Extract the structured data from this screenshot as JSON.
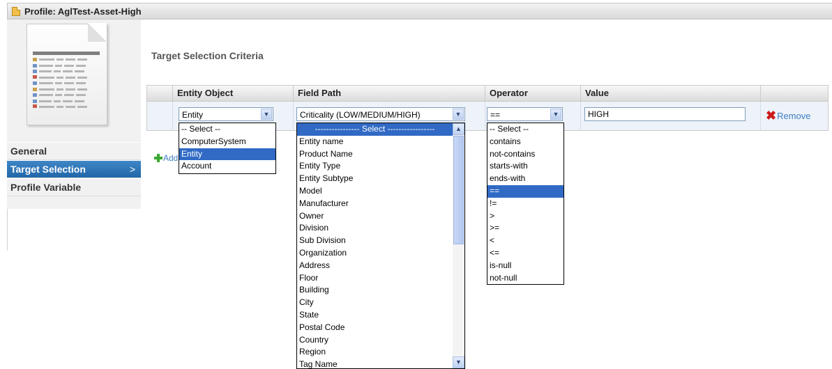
{
  "window": {
    "title": "Profile: AglTest-Asset-High"
  },
  "nav": {
    "items": [
      {
        "label": "General",
        "active": false
      },
      {
        "label": "Target Selection",
        "active": true,
        "chevron": ">"
      },
      {
        "label": "Profile Variable",
        "active": false
      }
    ]
  },
  "section": {
    "heading": "Target Selection Criteria"
  },
  "grid": {
    "columns": [
      "Entity Object",
      "Field Path",
      "Operator",
      "Value"
    ],
    "row": {
      "entity_object": "Entity",
      "field_path": "Criticality (LOW/MEDIUM/HIGH)",
      "operator": "==",
      "value": "HIGH",
      "remove_label": "Remove"
    }
  },
  "add_link": "Add",
  "dropdowns": {
    "entity_object": {
      "options": [
        "-- Select --",
        "ComputerSystem",
        "Entity",
        "Account"
      ],
      "highlighted": "Entity"
    },
    "field_path": {
      "options": [
        "---------------- Select -----------------",
        "Entity name",
        "Product Name",
        "Entity Type",
        "Entity Subtype",
        "Model",
        "Manufacturer",
        "Owner",
        "Division",
        "Sub Division",
        "Organization",
        "Address",
        "Floor",
        "Building",
        "City",
        "State",
        "Postal Code",
        "Country",
        "Region",
        "Tag Name"
      ],
      "highlighted": "---------------- Select -----------------"
    },
    "operator": {
      "options": [
        "-- Select --",
        "contains",
        "not-contains",
        "starts-with",
        "ends-with",
        "==",
        "!=",
        ">",
        ">=",
        "<",
        "<=",
        "is-null",
        "not-null"
      ],
      "highlighted": "=="
    }
  },
  "colors": {
    "accent": "#316ac5",
    "nav_active": "#2a72b5",
    "remove_x": "#cc1a1a",
    "link": "#3d7dc3"
  }
}
